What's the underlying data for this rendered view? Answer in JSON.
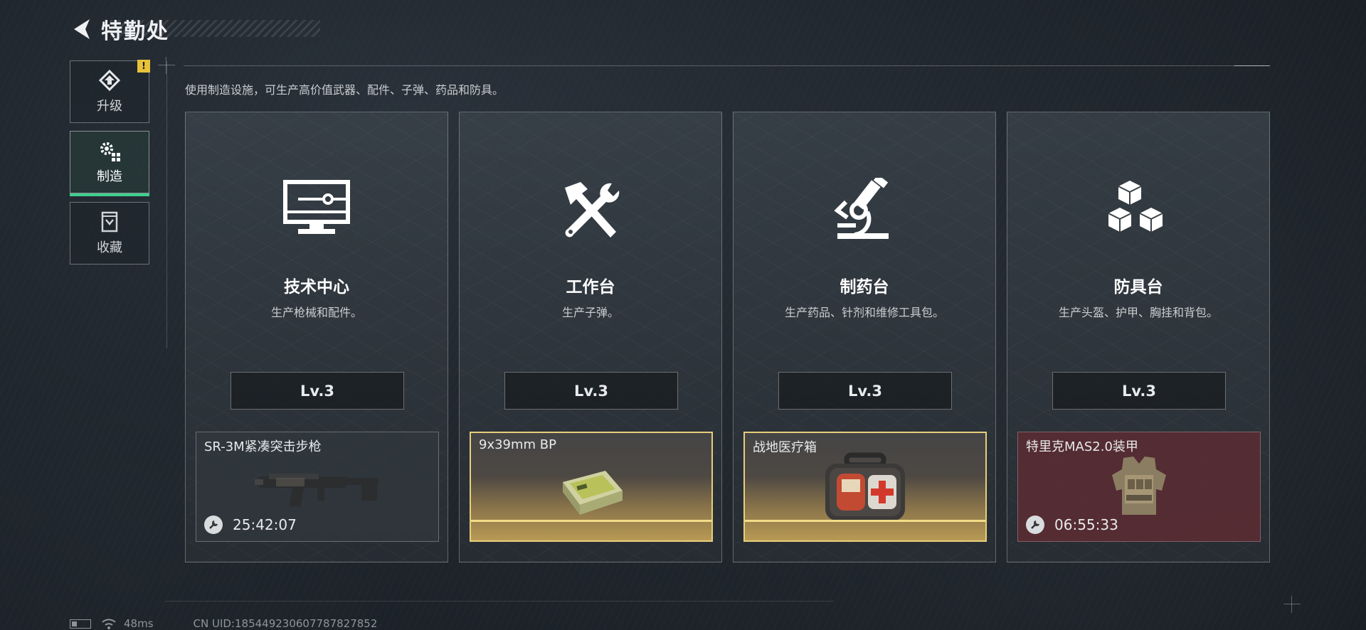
{
  "header": {
    "title": "特勤处",
    "back_icon": "back-arrow-icon"
  },
  "sidebar": {
    "tabs": [
      {
        "label": "升级",
        "icon": "upgrade-icon",
        "alert": "!"
      },
      {
        "label": "制造",
        "icon": "gears-icon",
        "active": true
      },
      {
        "label": "收藏",
        "icon": "collection-icon"
      }
    ]
  },
  "main": {
    "subtitle": "使用制造设施，可生产高价值武器、配件、子弹、药品和防具。",
    "stations": [
      {
        "name": "技术中心",
        "desc": "生产枪械和配件。",
        "level": "Lv.3",
        "icon": "monitor-icon",
        "item": {
          "name": "SR-3M紧凑突击步枪",
          "timer": "25:42:07",
          "image": "rifle-image",
          "style": "normal"
        }
      },
      {
        "name": "工作台",
        "desc": "生产子弹。",
        "level": "Lv.3",
        "icon": "hammer-wrench-icon",
        "item": {
          "name": "9x39mm BP",
          "timer": "",
          "image": "ammo-box-image",
          "style": "gold"
        }
      },
      {
        "name": "制药台",
        "desc": "生产药品、针剂和维修工具包。",
        "level": "Lv.3",
        "icon": "microscope-icon",
        "item": {
          "name": "战地医疗箱",
          "timer": "",
          "image": "medkit-image",
          "style": "gold"
        }
      },
      {
        "name": "防具台",
        "desc": "生产头盔、护甲、胸挂和背包。",
        "level": "Lv.3",
        "icon": "cubes-icon",
        "item": {
          "name": "特里克MAS2.0装甲",
          "timer": "06:55:33",
          "image": "body-armor-image",
          "style": "red"
        }
      }
    ]
  },
  "status_bar": {
    "ping": "48ms",
    "uid": "CN UID:1854492306077878278​52"
  },
  "colors": {
    "accent_green": "#3fcf8e",
    "gold": "#e7cf7a",
    "alert_yellow": "#e8c23a"
  }
}
